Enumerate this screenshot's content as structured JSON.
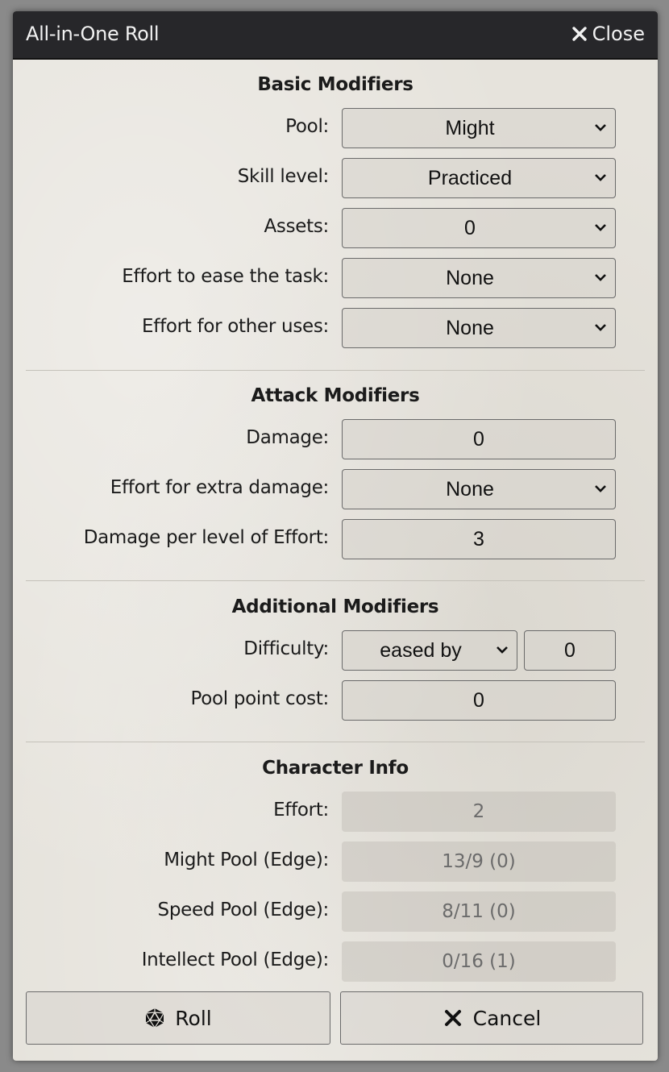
{
  "window": {
    "title": "All-in-One Roll",
    "close_label": "Close"
  },
  "basic": {
    "title": "Basic Modifiers",
    "pool": {
      "label": "Pool:",
      "value": "Might"
    },
    "skill": {
      "label": "Skill level:",
      "value": "Practiced"
    },
    "assets": {
      "label": "Assets:",
      "value": "0"
    },
    "effort_ease": {
      "label": "Effort to ease the task:",
      "value": "None"
    },
    "effort_other": {
      "label": "Effort for other uses:",
      "value": "None"
    }
  },
  "attack": {
    "title": "Attack Modifiers",
    "damage": {
      "label": "Damage:",
      "value": "0"
    },
    "effort_damage": {
      "label": "Effort for extra damage:",
      "value": "None"
    },
    "damage_per_level": {
      "label": "Damage per level of Effort:",
      "value": "3"
    }
  },
  "additional": {
    "title": "Additional Modifiers",
    "difficulty": {
      "label": "Difficulty:",
      "mode": "eased by",
      "value": "0"
    },
    "pool_cost": {
      "label": "Pool point cost:",
      "value": "0"
    }
  },
  "character": {
    "title": "Character Info",
    "effort": {
      "label": "Effort:",
      "value": "2"
    },
    "might": {
      "label": "Might Pool (Edge):",
      "value": "13/9 (0)"
    },
    "speed": {
      "label": "Speed Pool (Edge):",
      "value": "8/11 (0)"
    },
    "intellect": {
      "label": "Intellect Pool (Edge):",
      "value": "0/16 (1)"
    }
  },
  "buttons": {
    "roll": "Roll",
    "cancel": "Cancel"
  }
}
